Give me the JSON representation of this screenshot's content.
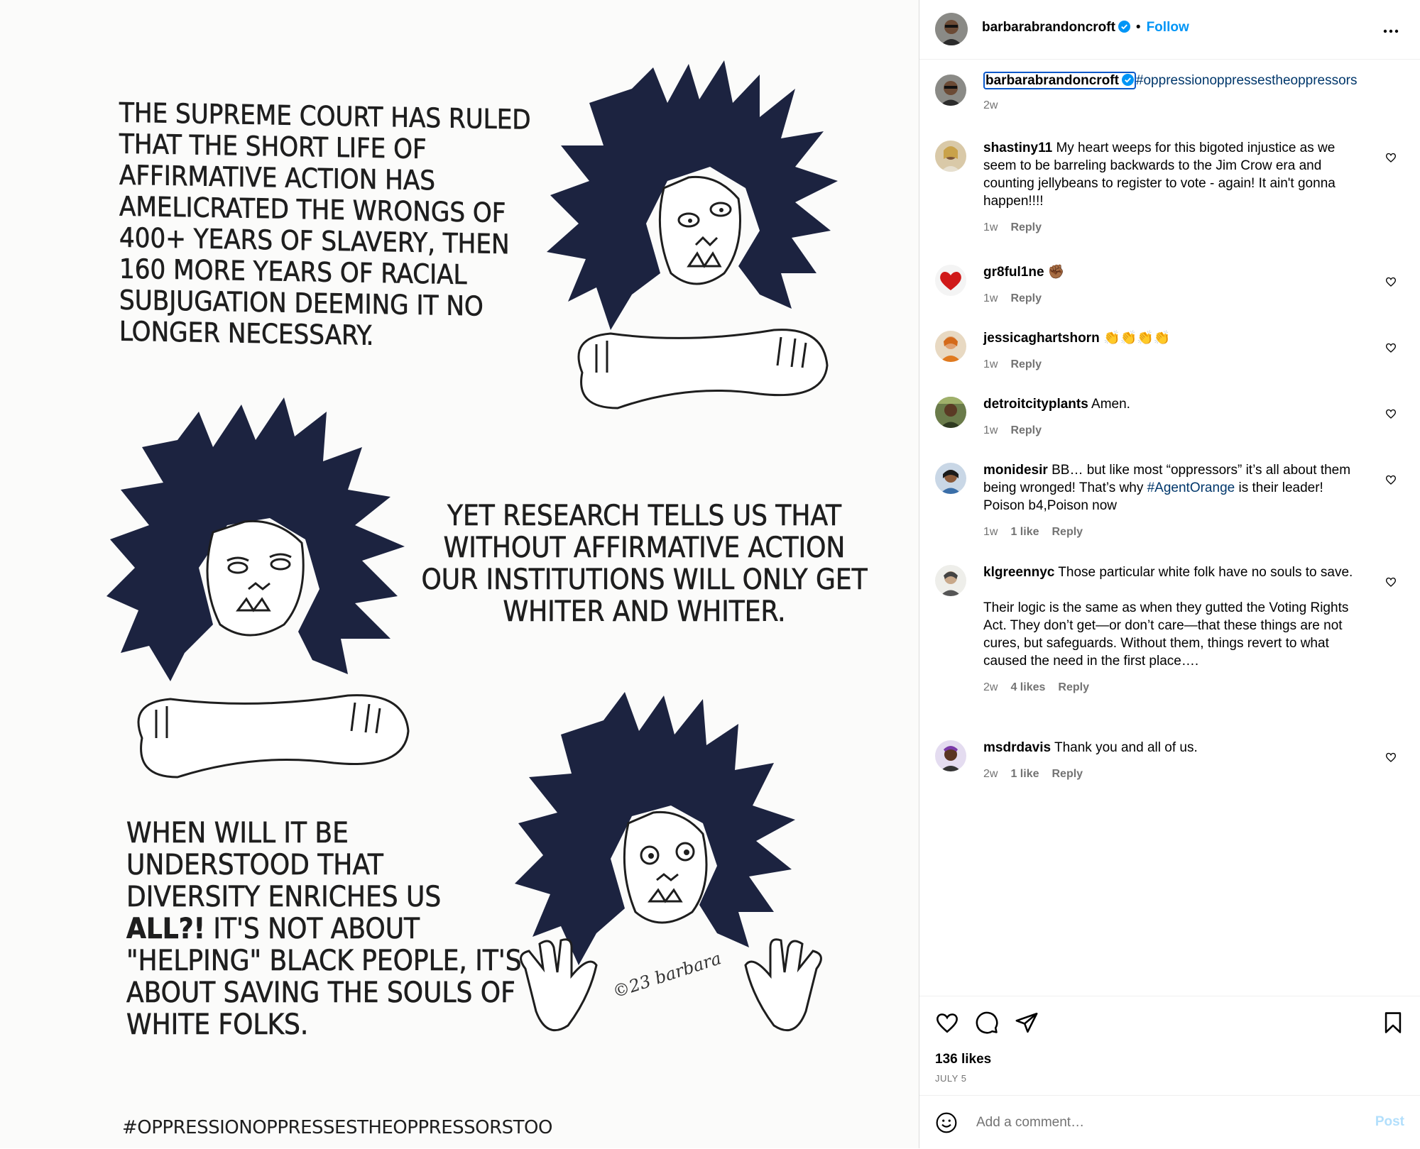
{
  "post": {
    "panel_1_text": "The Supreme Court has ruled that the short life of affirmative action has amelicrated the wrongs of 400+ years of slavery, then 160 more years of racial subjugation deeming it no longer necessary.",
    "panel_2_text": "Yet research tells us that without affirmative action our institutions will only get whiter and whiter.",
    "panel_3_text_a": "When will it be understood that diversity enriches us ",
    "panel_3_text_bold": "all?!",
    "panel_3_text_b": " It's not about \"helping\" black people, it's about saving the souls of white folks.",
    "signature": "©23 barbara",
    "hashtag": "#OPPRESSIONOPPRESSESTHEOPPRESSORSTOO"
  },
  "header": {
    "username": "barbarabrandoncroft",
    "separator": "•",
    "follow_label": "Follow",
    "more_icon": "more-horizontal-icon"
  },
  "caption": {
    "username": "barbarabrandoncroft",
    "hashtag": "#oppressionoppressestheoppressors",
    "time": "2w"
  },
  "comments": [
    {
      "username": "shastiny11",
      "text": "My heart weeps for this bigoted injustice as we seem to be barreling backwards to the Jim Crow era and counting jellybeans to register to vote - again! It ain't gonna happen!!!!",
      "time": "1w",
      "likes": "",
      "reply": "Reply"
    },
    {
      "username": "gr8ful1ne",
      "text": "✊🏾",
      "time": "1w",
      "likes": "",
      "reply": "Reply"
    },
    {
      "username": "jessicaghartshorn",
      "text": "👏👏👏👏",
      "time": "1w",
      "likes": "",
      "reply": "Reply"
    },
    {
      "username": "detroitcityplants",
      "text": "Amen.",
      "time": "1w",
      "likes": "",
      "reply": "Reply"
    },
    {
      "username": "monidesir",
      "text_a": "BB… but like most “oppressors” it’s all about them being wronged! That’s why ",
      "tag": "#AgentOrange",
      "text_b": " is their leader! Poison b4,Poison now",
      "time": "1w",
      "likes": "1 like",
      "reply": "Reply"
    },
    {
      "username": "klgreennyc",
      "text": "Those particular white folk have no souls to save.",
      "text_p2": "Their logic is the same as when they gutted the Voting Rights Act. They don’t get—or don’t care—that these things are not cures, but safeguards. Without them, things revert to what caused the need in the first place….",
      "time": "2w",
      "likes": "4 likes",
      "reply": "Reply"
    },
    {
      "username": "msdrdavis",
      "text": "Thank you and all of us.",
      "time": "2w",
      "likes": "1 like",
      "reply": "Reply"
    }
  ],
  "actions": {
    "likes": "136 likes",
    "date": "JULY 5"
  },
  "add_comment": {
    "placeholder": "Add a comment…",
    "post_label": "Post"
  },
  "colors": {
    "accent": "#0095f6",
    "hashtag": "#00376b",
    "muted": "#737373",
    "hair": "#1c2340"
  }
}
